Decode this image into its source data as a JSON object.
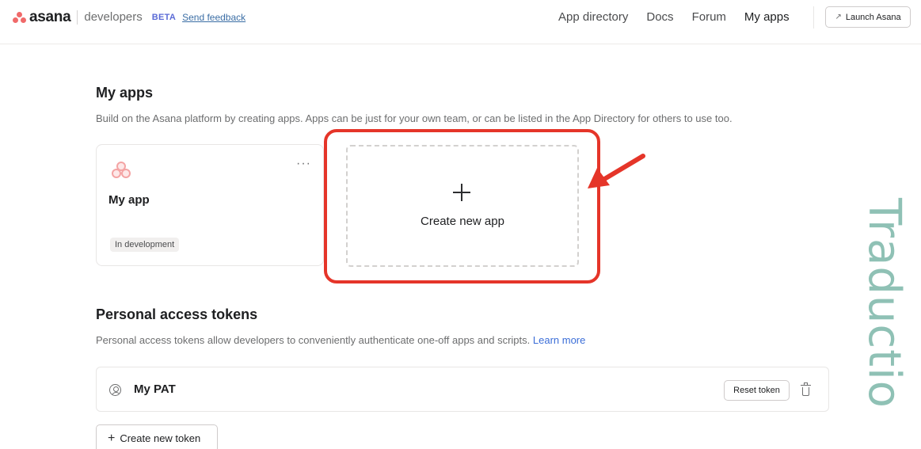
{
  "header": {
    "brand": "asana",
    "subtitle": "developers",
    "badge": "BETA",
    "feedback_link": "Send feedback",
    "nav": [
      "App directory",
      "Docs",
      "Forum",
      "My apps"
    ],
    "launch_button": "Launch Asana"
  },
  "my_apps": {
    "title": "My apps",
    "description": "Build on the Asana platform by creating apps. Apps can be just for your own team, or can be listed in the App Directory for others to use too.",
    "app": {
      "name": "My app",
      "status": "In development",
      "more_icon": "···"
    },
    "create_label": "Create new app"
  },
  "tokens": {
    "title": "Personal access tokens",
    "description": "Personal access tokens allow developers to conveniently authenticate one-off apps and scripts.",
    "learn_more": "Learn more",
    "items": [
      {
        "name": "My PAT",
        "reset_label": "Reset token"
      }
    ],
    "create_label": "Create new token"
  },
  "annotation": {
    "highlight_color": "#e53529",
    "watermark": "Traductio"
  },
  "colors": {
    "brand": "#f06a6a",
    "link": "#3b6ed8",
    "beta": "#5b6bd6"
  }
}
